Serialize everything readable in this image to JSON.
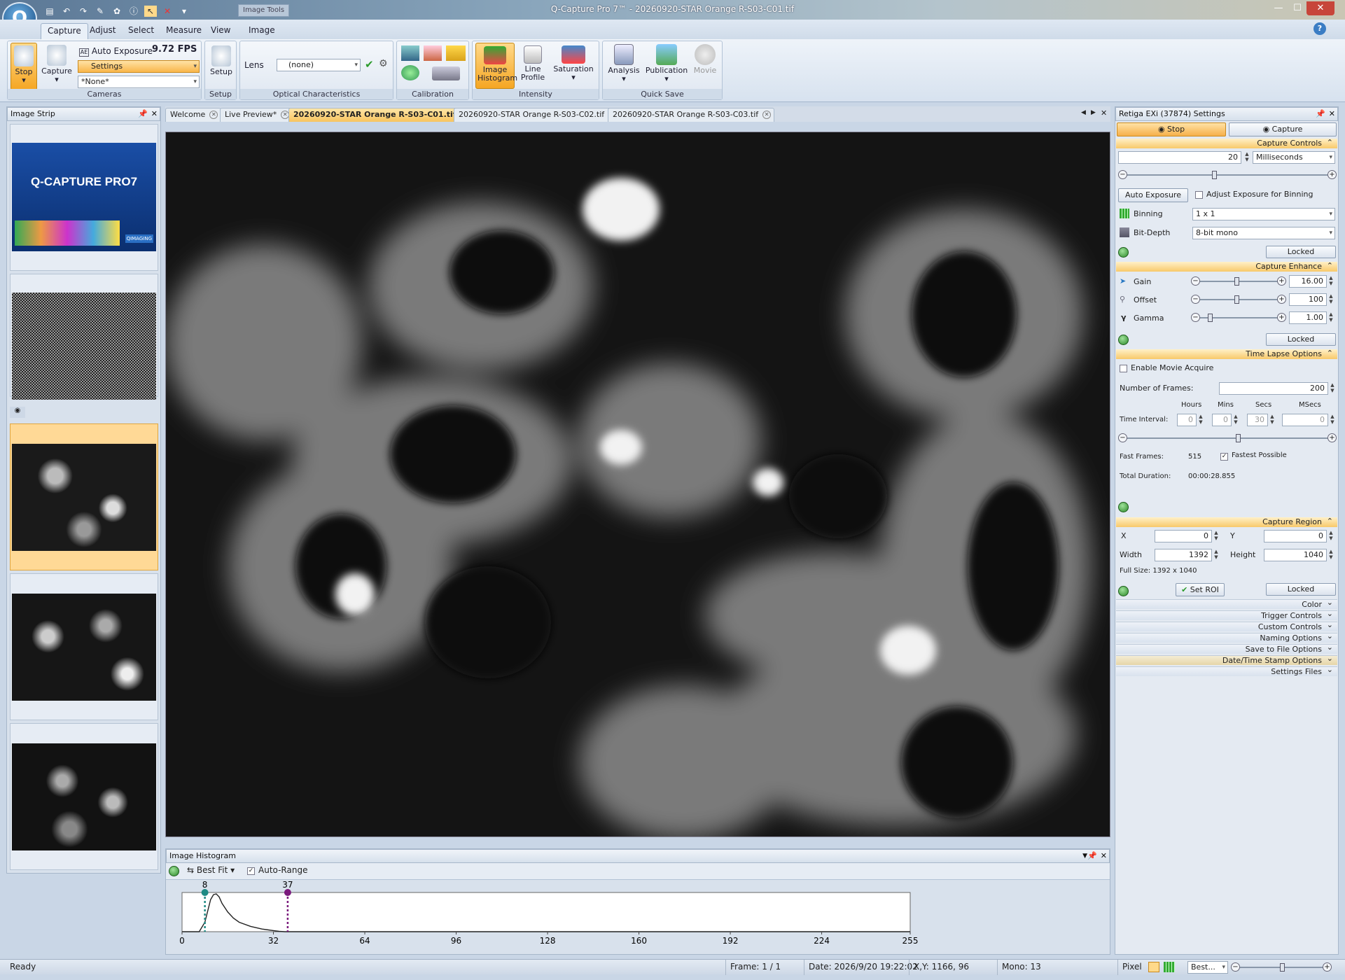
{
  "window": {
    "title": "Q-Capture Pro 7™ - 20260920-STAR Orange R-S03-C01.tif",
    "context_tab": "Image Tools",
    "app_logo_letter": "Q"
  },
  "menu": {
    "tabs": [
      "Capture",
      "Adjust",
      "Select",
      "Measure",
      "View",
      "Image"
    ],
    "active": "Capture"
  },
  "ribbon": {
    "cameras": {
      "stop_label": "Stop",
      "capture_label": "Capture",
      "auto_exposure_label": "Auto Exposure",
      "fps": "9.72 FPS",
      "settings_dropdown": "Settings",
      "preset_dropdown": "*None*",
      "group_label": "Cameras"
    },
    "setup": {
      "button_label": "Setup",
      "group_label": "Setup"
    },
    "optical": {
      "lens_label": "Lens",
      "lens_value": "(none)",
      "group_label": "Optical Characteristics"
    },
    "calibration": {
      "group_label": "Calibration"
    },
    "intensity": {
      "image_histogram": "Image Histogram",
      "line_profile": "Line Profile",
      "saturation": "Saturation",
      "group_label": "Intensity"
    },
    "quick_save": {
      "analysis": "Analysis",
      "publication": "Publication",
      "movie": "Movie",
      "group_label": "Quick Save"
    }
  },
  "image_strip": {
    "title": "Image Strip",
    "splash_title": "Q-CAPTURE PRO7",
    "splash_brand": "QIMAGING"
  },
  "doc_tabs": [
    {
      "label": "Welcome",
      "active": false
    },
    {
      "label": "Live Preview*",
      "active": false
    },
    {
      "label": "20260920-STAR Orange R-S03-C01.tif",
      "active": true
    },
    {
      "label": "20260920-STAR Orange R-S03-C02.tif",
      "active": false
    },
    {
      "label": "20260920-STAR Orange R-S03-C03.tif",
      "active": false
    }
  ],
  "histogram": {
    "title": "Image Histogram",
    "fit_label": "Best Fit",
    "auto_range_label": "Auto-Range",
    "black_marker": "8",
    "white_marker": "37",
    "x_ticks": [
      "0",
      "32",
      "64",
      "96",
      "128",
      "160",
      "192",
      "224",
      "255"
    ],
    "chart_data": {
      "type": "line",
      "x_range": [
        0,
        255
      ],
      "black_point": 8,
      "white_point": 37,
      "x": [
        0,
        6,
        8,
        9,
        10,
        11,
        12,
        13,
        14,
        16,
        18,
        20,
        24,
        28,
        32,
        34,
        36,
        255
      ],
      "y": [
        0,
        0,
        0.25,
        0.55,
        0.85,
        0.98,
        1.0,
        0.92,
        0.75,
        0.52,
        0.36,
        0.25,
        0.14,
        0.07,
        0.03,
        0.01,
        0,
        0
      ]
    }
  },
  "settings_panel": {
    "title": "Retiga EXi (37874) Settings",
    "stop_label": "Stop",
    "capture_label": "Capture",
    "capture_controls": {
      "header": "Capture Controls",
      "exposure_value": "20",
      "exposure_unit": "Milliseconds",
      "auto_exposure_button": "Auto Exposure",
      "adjust_binning_label": "Adjust Exposure for Binning",
      "binning_label": "Binning",
      "binning_value": "1 x 1",
      "bitdepth_label": "Bit-Depth",
      "bitdepth_value": "8-bit mono",
      "locked_label": "Locked"
    },
    "capture_enhance": {
      "header": "Capture Enhance",
      "gain_label": "Gain",
      "gain_value": "16.00",
      "offset_label": "Offset",
      "offset_value": "100",
      "gamma_label": "Gamma",
      "gamma_value": "1.00",
      "locked_label": "Locked"
    },
    "time_lapse": {
      "header": "Time Lapse Options",
      "enable_movie_label": "Enable Movie Acquire",
      "num_frames_label": "Number of Frames:",
      "num_frames_value": "200",
      "col_hours": "Hours",
      "col_mins": "Mins",
      "col_secs": "Secs",
      "col_msecs": "MSecs",
      "interval_label": "Time Interval:",
      "hours_value": "0",
      "mins_value": "0",
      "secs_value": "30",
      "msecs_value": "0",
      "fast_frames_label": "Fast Frames:",
      "fast_frames_value": "515",
      "fastest_possible_label": "Fastest Possible",
      "total_duration_label": "Total Duration:",
      "total_duration_value": "00:00:28.855"
    },
    "capture_region": {
      "header": "Capture Region",
      "x_label": "X",
      "x_value": "0",
      "y_label": "Y",
      "y_value": "0",
      "width_label": "Width",
      "width_value": "1392",
      "height_label": "Height",
      "height_value": "1040",
      "full_size": "Full Size: 1392 x 1040",
      "set_roi_label": "Set ROI",
      "locked_label": "Locked"
    },
    "collapsed_sections": [
      "Color",
      "Trigger Controls",
      "Custom Controls",
      "Naming Options",
      "Save to File Options",
      "Date/Time Stamp Options",
      "Settings Files"
    ]
  },
  "status": {
    "ready": "Ready",
    "frame": "Frame: 1 / 1",
    "date": "Date: 2026/9/20 19:22:02",
    "xy": "X,Y: 1166,   96",
    "mono": "Mono:     13",
    "pixel": "Pixel",
    "zoom": "Best..."
  },
  "colors": {
    "accent_orange": "#f7c45f",
    "ribbon_blue": "#d7e2ef",
    "marker_teal": "#1f8a84",
    "marker_purple": "#7a1a7c"
  }
}
